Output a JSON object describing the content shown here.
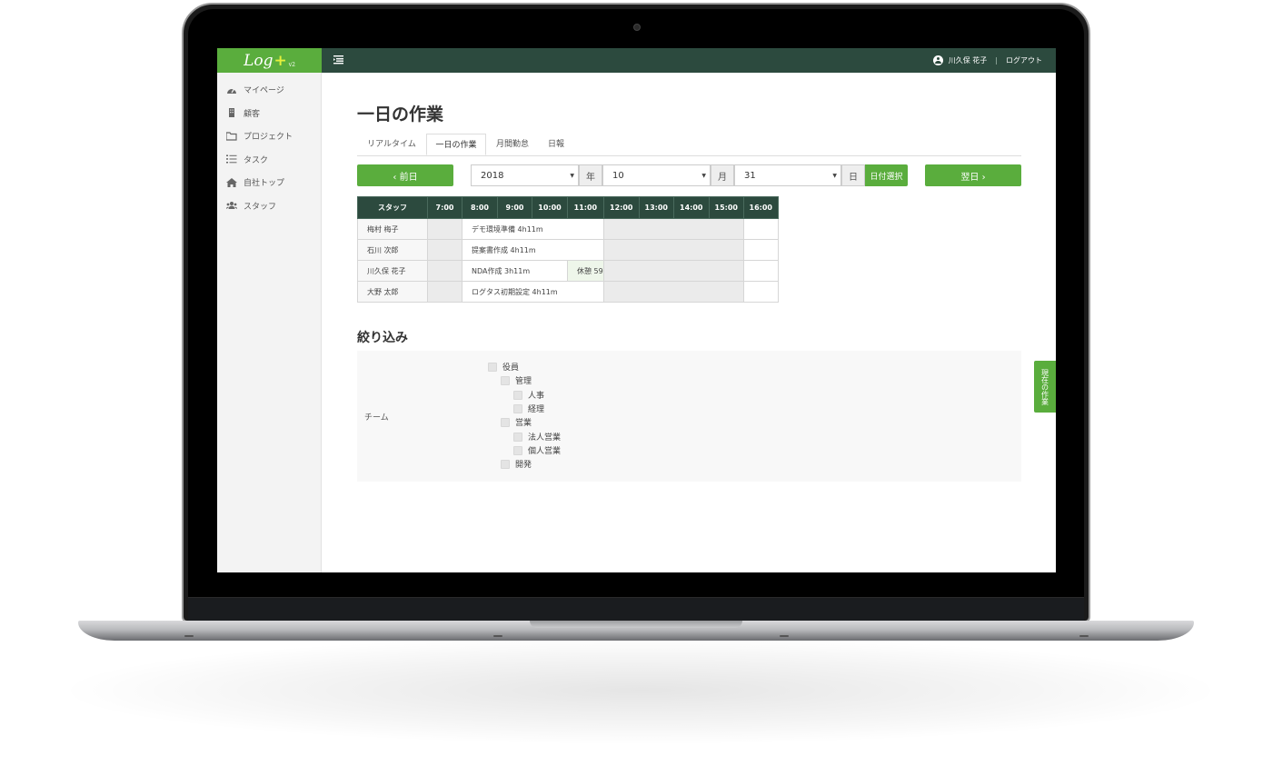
{
  "app": {
    "logo_text": "Log",
    "logo_plus": "+",
    "logo_version": "v2",
    "menu_icon": "menu-collapse-icon"
  },
  "header": {
    "user_icon": "user-circle-icon",
    "user_name": "川久保 花子",
    "separator": "|",
    "logout_label": "ログアウト"
  },
  "sidebar": {
    "items": [
      {
        "label": "マイページ",
        "icon": "dashboard-icon"
      },
      {
        "label": "顧客",
        "icon": "building-icon"
      },
      {
        "label": "プロジェクト",
        "icon": "folder-icon"
      },
      {
        "label": "タスク",
        "icon": "list-icon"
      },
      {
        "label": "自社トップ",
        "icon": "home-icon"
      },
      {
        "label": "スタッフ",
        "icon": "users-icon"
      }
    ]
  },
  "page": {
    "title": "一日の作業",
    "tabs": [
      {
        "label": "リアルタイム",
        "active": false
      },
      {
        "label": "一日の作業",
        "active": true
      },
      {
        "label": "月間勤怠",
        "active": false
      },
      {
        "label": "日報",
        "active": false
      }
    ]
  },
  "date_nav": {
    "prev_label": "‹ 前日",
    "next_label": "翌日 ›",
    "year_value": "2018",
    "year_unit": "年",
    "month_value": "10",
    "month_unit": "月",
    "day_value": "31",
    "day_unit": "日",
    "select_date_label": "日付選択"
  },
  "schedule": {
    "staff_header": "スタッフ",
    "hours": [
      "7:00",
      "8:00",
      "9:00",
      "10:00",
      "11:00",
      "12:00",
      "13:00",
      "14:00",
      "15:00",
      "16:00"
    ],
    "rows": [
      {
        "staff": "梅村 梅子",
        "task": "デモ環境準備 4h11m"
      },
      {
        "staff": "石川 次郎",
        "task": "提案書作成 4h11m"
      },
      {
        "staff": "川久保 花子",
        "task": "NDA作成 3h11m",
        "rest": "休憩 59"
      },
      {
        "staff": "大野 太郎",
        "task": "ログタス初期設定 4h11m"
      }
    ]
  },
  "filter": {
    "title": "絞り込み",
    "team_label": "チーム",
    "teams": [
      {
        "label": "役員",
        "level": 0
      },
      {
        "label": "管理",
        "level": 1
      },
      {
        "label": "人事",
        "level": 2
      },
      {
        "label": "経理",
        "level": 2
      },
      {
        "label": "営業",
        "level": 1
      },
      {
        "label": "法人営業",
        "level": 2
      },
      {
        "label": "個人営業",
        "level": 2
      },
      {
        "label": "開発",
        "level": 1
      }
    ]
  },
  "current_work_tab": "現在の作業",
  "colors": {
    "brand_green": "#5aad3d",
    "header_dark": "#2c4a3e"
  }
}
